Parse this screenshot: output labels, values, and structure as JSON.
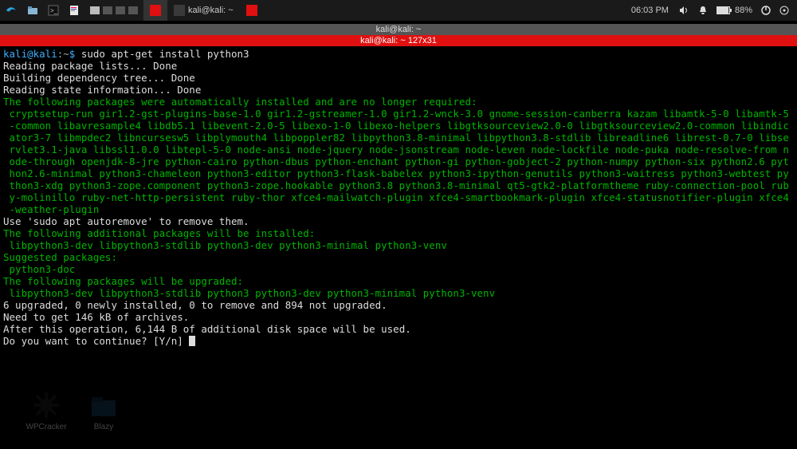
{
  "panel": {
    "tasks": [
      {
        "label": "kali@kali: ~",
        "color": "#e01010",
        "active": false
      }
    ],
    "active_task_color": "#e01010",
    "clock": "06:03 PM",
    "battery": "88%"
  },
  "window": {
    "title_inactive": "kali@kali: ~",
    "title_active": "kali@kali: ~ 127x31"
  },
  "prompt": {
    "user": "kali@kali",
    "sep": ":",
    "path": "~",
    "dollar": "$",
    "command": "sudo apt-get install python3"
  },
  "output": {
    "reading_lists": "Reading package lists... Done",
    "building_tree": "Building dependency tree... Done",
    "reading_state": "Reading state information... Done",
    "auto_header": "The following packages were automatically installed and are no longer required:",
    "auto_pkgs": "cryptsetup-run gir1.2-gst-plugins-base-1.0 gir1.2-gstreamer-1.0 gir1.2-wnck-3.0 gnome-session-canberra kazam libamtk-5-0 libamtk-5-common libavresample4 libdb5.1 libevent-2.0-5 libexo-1-0 libexo-helpers libgtksourceview2.0-0 libgtksourceview2.0-common libindicator3-7 libmpdec2 libncursesw5 libplymouth4 libpoppler82 libpython3.8-minimal libpython3.8-stdlib libreadline6 librest-0.7-0 libservlet3.1-java libssl1.0.0 libtepl-5-0 node-ansi node-jquery node-jsonstream node-leven node-lockfile node-puka node-resolve-from node-through openjdk-8-jre python-cairo python-dbus python-enchant python-gi python-gobject-2 python-numpy python-six python2.6 python2.6-minimal python3-chameleon python3-editor python3-flask-babelex python3-ipython-genutils python3-waitress python3-webtest python3-xdg python3-zope.component python3-zope.hookable python3.8 python3.8-minimal qt5-gtk2-platformtheme ruby-connection-pool ruby-molinillo ruby-net-http-persistent ruby-thor xfce4-mailwatch-plugin xfce4-smartbookmark-plugin xfce4-statusnotifier-plugin xfce4-weather-plugin",
    "autoremove": "Use 'sudo apt autoremove' to remove them.",
    "additional_header": "The following additional packages will be installed:",
    "additional_pkgs": "libpython3-dev libpython3-stdlib python3-dev python3-minimal python3-venv",
    "suggested_header": "Suggested packages:",
    "suggested_pkgs": "python3-doc",
    "upgrade_header": "The following packages will be upgraded:",
    "upgrade_pkgs": "libpython3-dev libpython3-stdlib python3 python3-dev python3-minimal python3-venv",
    "summary": "6 upgraded, 0 newly installed, 0 to remove and 894 not upgraded.",
    "need_get": "Need to get 146 kB of archives.",
    "after_op": "After this operation, 6,144 B of additional disk space will be used.",
    "continue": "Do you want to continue? [Y/n] "
  },
  "desktop": {
    "icon1": "WPCracker",
    "icon2": "Blazy"
  }
}
